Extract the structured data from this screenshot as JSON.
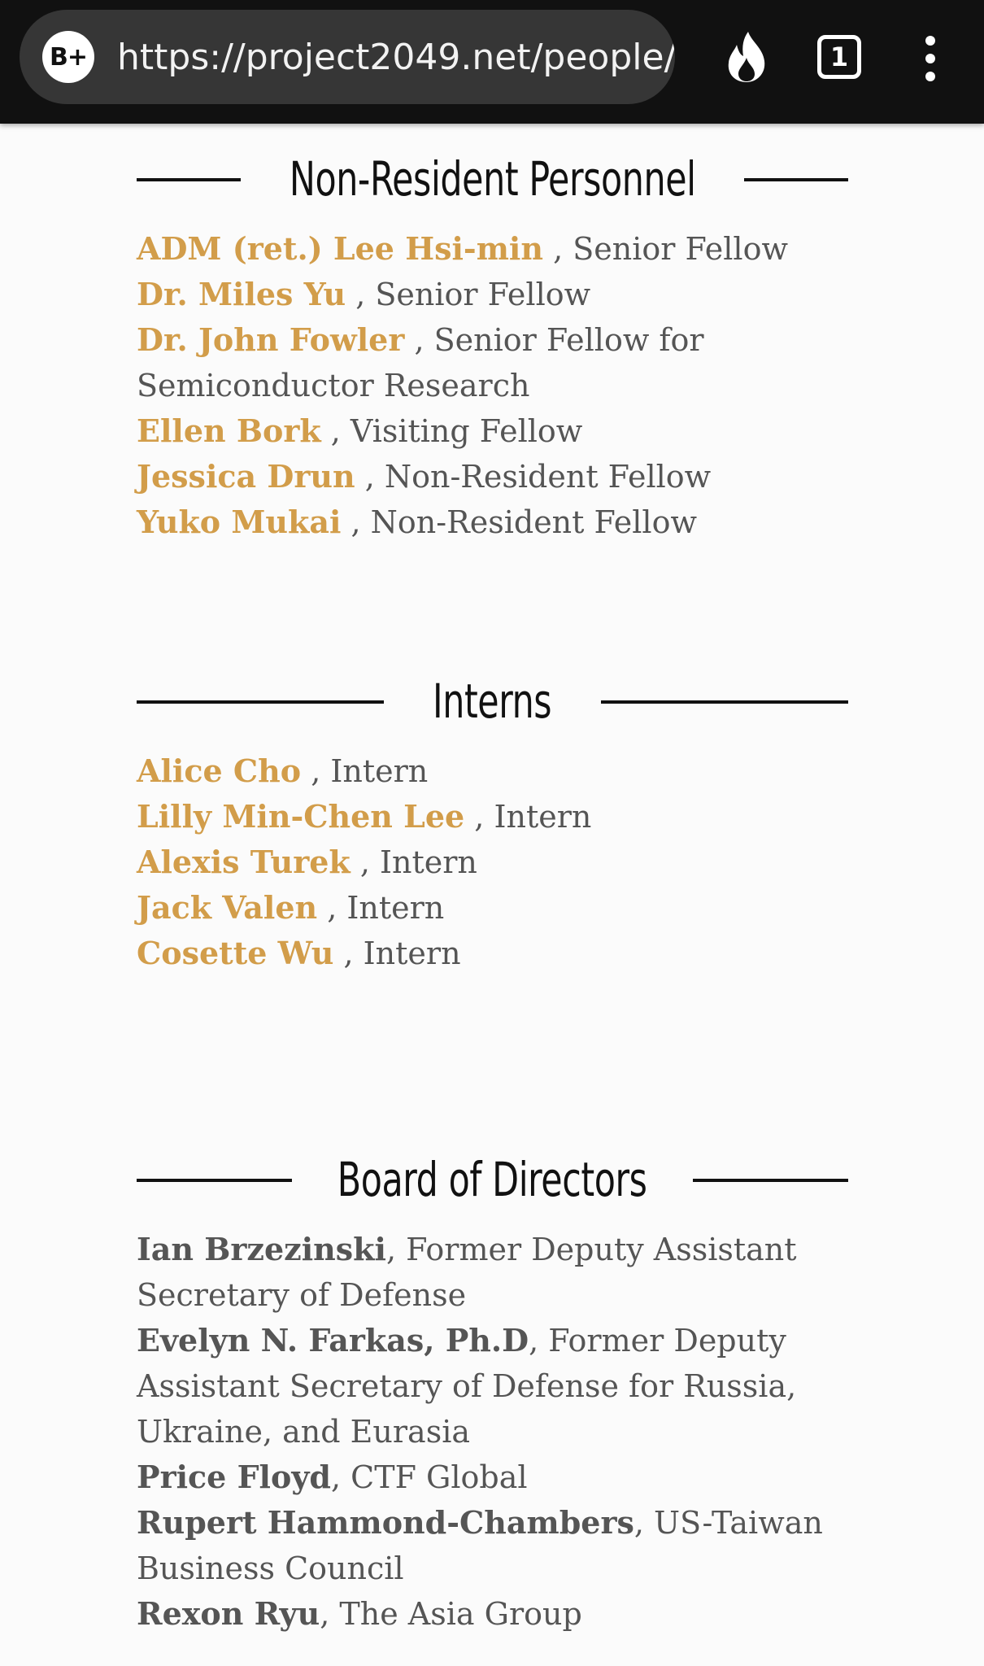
{
  "browser": {
    "badge": "B+",
    "url": "https://project2049.net/people/",
    "tab_count": "1"
  },
  "sections": {
    "non_resident": {
      "title": "Non-Resident Personnel",
      "entries": [
        {
          "name": "ADM (ret.) Lee Hsi-min",
          "role": " , Senior Fellow"
        },
        {
          "name": "Dr. Miles Yu",
          "role": " , Senior Fellow"
        },
        {
          "name": "Dr. John Fowler",
          "role": " , Senior Fellow for Semiconductor Research"
        },
        {
          "name": "Ellen Bork",
          "role": " , Visiting Fellow"
        },
        {
          "name": "Jessica Drun",
          "role": " , Non-Resident Fellow"
        },
        {
          "name": "Yuko Mukai",
          "role": " , Non-Resident Fellow"
        }
      ]
    },
    "interns": {
      "title": "Interns",
      "entries": [
        {
          "name": "Alice Cho",
          "role": " , Intern"
        },
        {
          "name": "Lilly Min-Chen Lee",
          "role": " , Intern"
        },
        {
          "name": "Alexis Turek",
          "role": " , Intern"
        },
        {
          "name": "Jack Valen",
          "role": " , Intern"
        },
        {
          "name": "Cosette Wu",
          "role": " , Intern"
        }
      ]
    },
    "board": {
      "title": "Board of Directors",
      "entries": [
        {
          "name": "Ian Brzezinski",
          "role": ", Former Deputy Assistant Secretary of Defense"
        },
        {
          "name": "Evelyn N. Farkas, Ph.D",
          "role": ", Former Deputy Assistant Secretary of Defense for Russia, Ukraine, and Eurasia"
        },
        {
          "name": "Price Floyd",
          "role": ", CTF Global"
        },
        {
          "name": "Rupert Hammond-Chambers",
          "role": ", US-Taiwan Business Council"
        },
        {
          "name": "Rexon Ryu",
          "role": ", The Asia Group"
        }
      ]
    }
  }
}
